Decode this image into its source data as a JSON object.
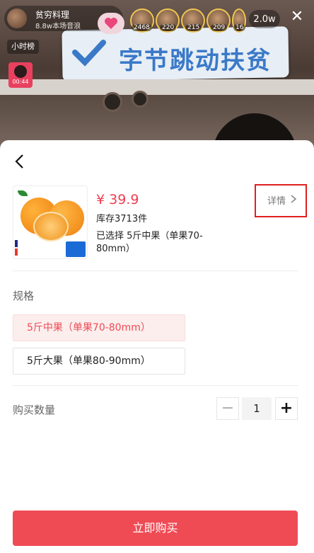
{
  "live": {
    "host_name": "贫穷料理",
    "host_sub": "8.8w本场音浪",
    "viewers": [
      {
        "count": "2468"
      },
      {
        "count": "220"
      },
      {
        "count": "215"
      },
      {
        "count": "209"
      },
      {
        "count": "16"
      }
    ],
    "online_count": "2.0w",
    "hourly_rank": "小时榜",
    "countdown": "00:44",
    "banner_text": "字节跳动扶贫"
  },
  "product": {
    "price": "¥ 39.9",
    "stock": "库存3713件",
    "selected": "已选择  5斤中果（单果70-80mm）",
    "detail_label": "详情"
  },
  "spec": {
    "label": "规格",
    "options": [
      {
        "label": "5斤中果（单果70-80mm）",
        "selected": true
      },
      {
        "label": "5斤大果（单果80-90mm）",
        "selected": false
      }
    ]
  },
  "quantity": {
    "label": "购买数量",
    "value": "1",
    "minus": "−",
    "plus": "+"
  },
  "buy_button": "立即购买",
  "colors": {
    "accent": "#ef4b55",
    "price": "#f03c50",
    "highlight_box": "#e02020"
  },
  "icons": [
    "back-arrow-icon",
    "chevron-right-icon",
    "close-icon",
    "heart-icon"
  ]
}
